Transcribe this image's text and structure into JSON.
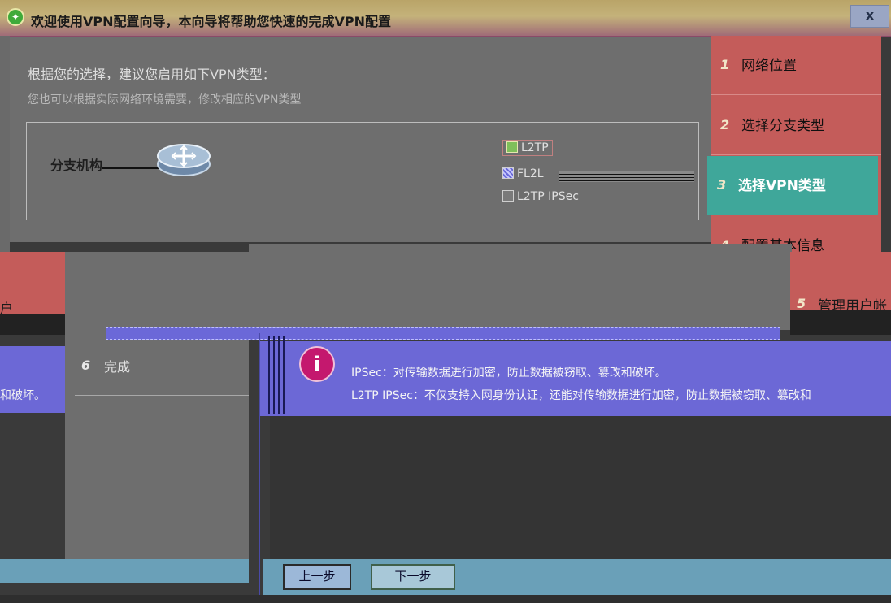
{
  "title_bar": {
    "title": "欢迎使用VPN配置向导，本向导将帮助您快速的完成VPN配置",
    "close_label": "x",
    "icon": "wizard-icon"
  },
  "main": {
    "heading": "根据您的选择，建议您启用如下VPN类型：",
    "subheading": "您也可以根据实际网络环境需要，修改相应的VPN类型",
    "branch_label": "分支机构",
    "options": [
      {
        "label": "L2TP",
        "checked": true
      },
      {
        "label": "FL2L",
        "checked": "partial"
      },
      {
        "label": "L2TP IPSec",
        "checked": false
      }
    ]
  },
  "steps": [
    {
      "num": "1",
      "label": "网络位置"
    },
    {
      "num": "2",
      "label": "选择分支类型"
    },
    {
      "num": "3",
      "label": "选择VPN类型",
      "active": true
    },
    {
      "num": "4",
      "label": "配置基本信息"
    },
    {
      "num": "5",
      "label": "管理用户帐"
    }
  ],
  "fragments": {
    "left_red_text": "户",
    "left_blue_text": "和破坏。",
    "done_num": "6",
    "done_label": "完成"
  },
  "info": {
    "line1": "IPSec：对传输数据进行加密，防止数据被窃取、篡改和破坏。",
    "line2": "L2TP IPSec：不仅支持入网身份认证，还能对传输数据进行加密，防止数据被窃取、篡改和"
  },
  "buttons": {
    "prev": "上一步",
    "next": "下一步"
  },
  "colors": {
    "step_bg": "#c45c5a",
    "step_active": "#3fa79a",
    "info_bg": "#6c68d6"
  }
}
